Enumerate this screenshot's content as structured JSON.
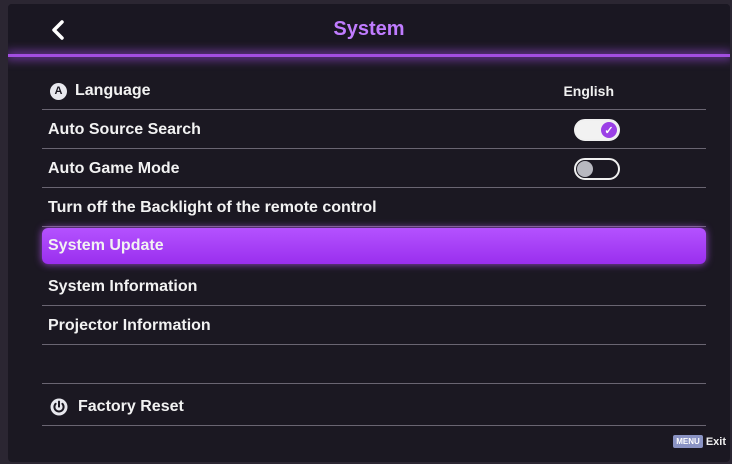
{
  "header": {
    "title": "System",
    "back_icon": "chevron-left-icon"
  },
  "menu": {
    "items": [
      {
        "label": "Language",
        "icon": "language-a-icon",
        "value": "English"
      },
      {
        "label": "Auto Source Search",
        "toggle": "on"
      },
      {
        "label": "Auto Game Mode",
        "toggle": "off"
      },
      {
        "label": "Turn off the Backlight of the remote control"
      },
      {
        "label": "System Update",
        "selected": true
      },
      {
        "label": "System Information"
      },
      {
        "label": "Projector Information"
      },
      {
        "label": ""
      },
      {
        "label": "Factory Reset",
        "icon": "power-reset-icon"
      }
    ]
  },
  "footer": {
    "menu_key": "MENU",
    "exit_label": "Exit"
  },
  "colors": {
    "accent": "#a24ee0",
    "selected_bg": "#a93af5",
    "background": "#1b1822"
  }
}
